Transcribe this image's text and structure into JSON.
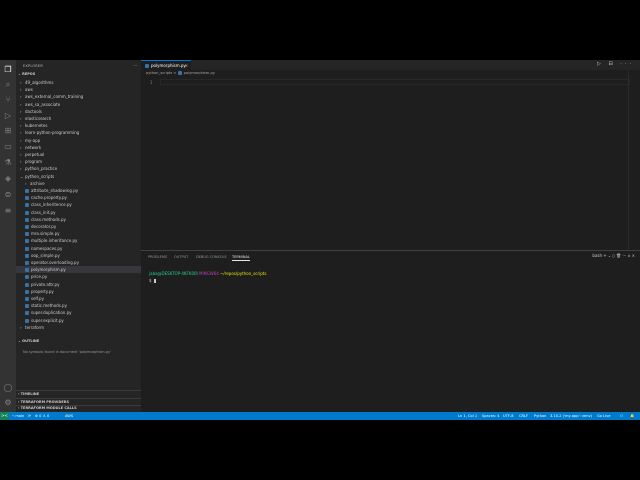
{
  "activity_bar": {
    "icons": [
      "files-icon",
      "search-icon",
      "source-control-icon",
      "run-debug-icon",
      "extensions-icon",
      "remote-explorer-icon",
      "testing-icon",
      "docker-icon",
      "database-icon",
      "tree-icon",
      "account-icon",
      "settings-gear-icon"
    ]
  },
  "sidebar": {
    "title": "EXPLORER",
    "more": "···",
    "workspace": "REPOS",
    "tree": [
      {
        "label": "49_algorithms",
        "type": "folder",
        "depth": 1
      },
      {
        "label": "aws",
        "type": "folder",
        "depth": 1
      },
      {
        "label": "aws_external_comm_training",
        "type": "folder",
        "depth": 1
      },
      {
        "label": "aws_sa_associate",
        "type": "folder",
        "depth": 1
      },
      {
        "label": "dactools",
        "type": "folder",
        "depth": 1
      },
      {
        "label": "elasticsearch",
        "type": "folder",
        "depth": 1
      },
      {
        "label": "kubernetes",
        "type": "folder",
        "depth": 1
      },
      {
        "label": "learn-python-programming",
        "type": "folder",
        "depth": 1
      },
      {
        "label": "my-app",
        "type": "folder",
        "depth": 1
      },
      {
        "label": "network",
        "type": "folder",
        "depth": 1
      },
      {
        "label": "perpetual",
        "type": "folder",
        "depth": 1
      },
      {
        "label": "program",
        "type": "folder",
        "depth": 1
      },
      {
        "label": "python_practice",
        "type": "folder",
        "depth": 1
      },
      {
        "label": "python_scripts",
        "type": "folder-open",
        "depth": 1
      },
      {
        "label": "archive",
        "type": "folder",
        "depth": 2
      },
      {
        "label": "attribute_shadowing.py",
        "type": "file",
        "depth": 2
      },
      {
        "label": "cache.property.py",
        "type": "file",
        "depth": 2
      },
      {
        "label": "class_inheritence.py",
        "type": "file",
        "depth": 2
      },
      {
        "label": "class_init.py",
        "type": "file",
        "depth": 2
      },
      {
        "label": "class.methods.py",
        "type": "file",
        "depth": 2
      },
      {
        "label": "decorator.py",
        "type": "file",
        "depth": 2
      },
      {
        "label": "mro.simple.py",
        "type": "file",
        "depth": 2
      },
      {
        "label": "multiple.inheritance.py",
        "type": "file",
        "depth": 2
      },
      {
        "label": "namespaces.py",
        "type": "file",
        "depth": 2
      },
      {
        "label": "oop_simple.py",
        "type": "file",
        "depth": 2
      },
      {
        "label": "operator.overloading.py",
        "type": "file",
        "depth": 2
      },
      {
        "label": "polymorphism.py",
        "type": "file",
        "depth": 2,
        "selected": true
      },
      {
        "label": "price.py",
        "type": "file",
        "depth": 2
      },
      {
        "label": "private.attr.py",
        "type": "file",
        "depth": 2
      },
      {
        "label": "property.py",
        "type": "file",
        "depth": 2
      },
      {
        "label": "self.py",
        "type": "file",
        "depth": 2
      },
      {
        "label": "static.methods.py",
        "type": "file",
        "depth": 2
      },
      {
        "label": "super.duplication.py",
        "type": "file",
        "depth": 2
      },
      {
        "label": "super.explicit.py",
        "type": "file",
        "depth": 2
      },
      {
        "label": "terraform",
        "type": "folder",
        "depth": 1
      }
    ],
    "outline_title": "OUTLINE",
    "outline_message": "No symbols found in document 'polymorphism.py'",
    "bottom_sections": [
      "TIMELINE",
      "TERRAFORM PROVIDERS",
      "TERRAFORM MODULE CALLS"
    ]
  },
  "editor": {
    "tab_label": "polymorphism.py",
    "tab_close": "×",
    "actions": "▷ ⊟ ···",
    "breadcrumb": [
      "python_scripts",
      ">",
      "polymorphism.py"
    ],
    "line_numbers": [
      "1"
    ]
  },
  "panel": {
    "tabs": [
      "PROBLEMS",
      "OUTPUT",
      "DEBUG CONSOLE",
      "TERMINAL"
    ],
    "active_tab": "TERMINAL",
    "actions": "bash + ⌄ ▯ 🗑 ··· ∧ ×",
    "terminal": {
      "user_host": "jaba@DESKTOP-4KFK00I",
      "system": "MINGW64",
      "path": "~/repos/python_scripts",
      "prompt": "$"
    }
  },
  "status_bar": {
    "remote": "><",
    "branch": "main",
    "sync": "⟳",
    "problems": "⊗ 0 ⚠ 0",
    "aws": "AWS",
    "right": [
      "Ln 1, Col 1",
      "Spaces: 4",
      "UTF-8",
      "CRLF",
      "Python",
      "3.10.2 ('my-app': venv)",
      "Go Live",
      "⚇",
      "🔔"
    ]
  },
  "colors": {
    "activity_bar": "#333333",
    "sidebar": "#252526",
    "editor": "#1e1e1e",
    "status_bar": "#007acc",
    "accent": "#0078d4"
  }
}
